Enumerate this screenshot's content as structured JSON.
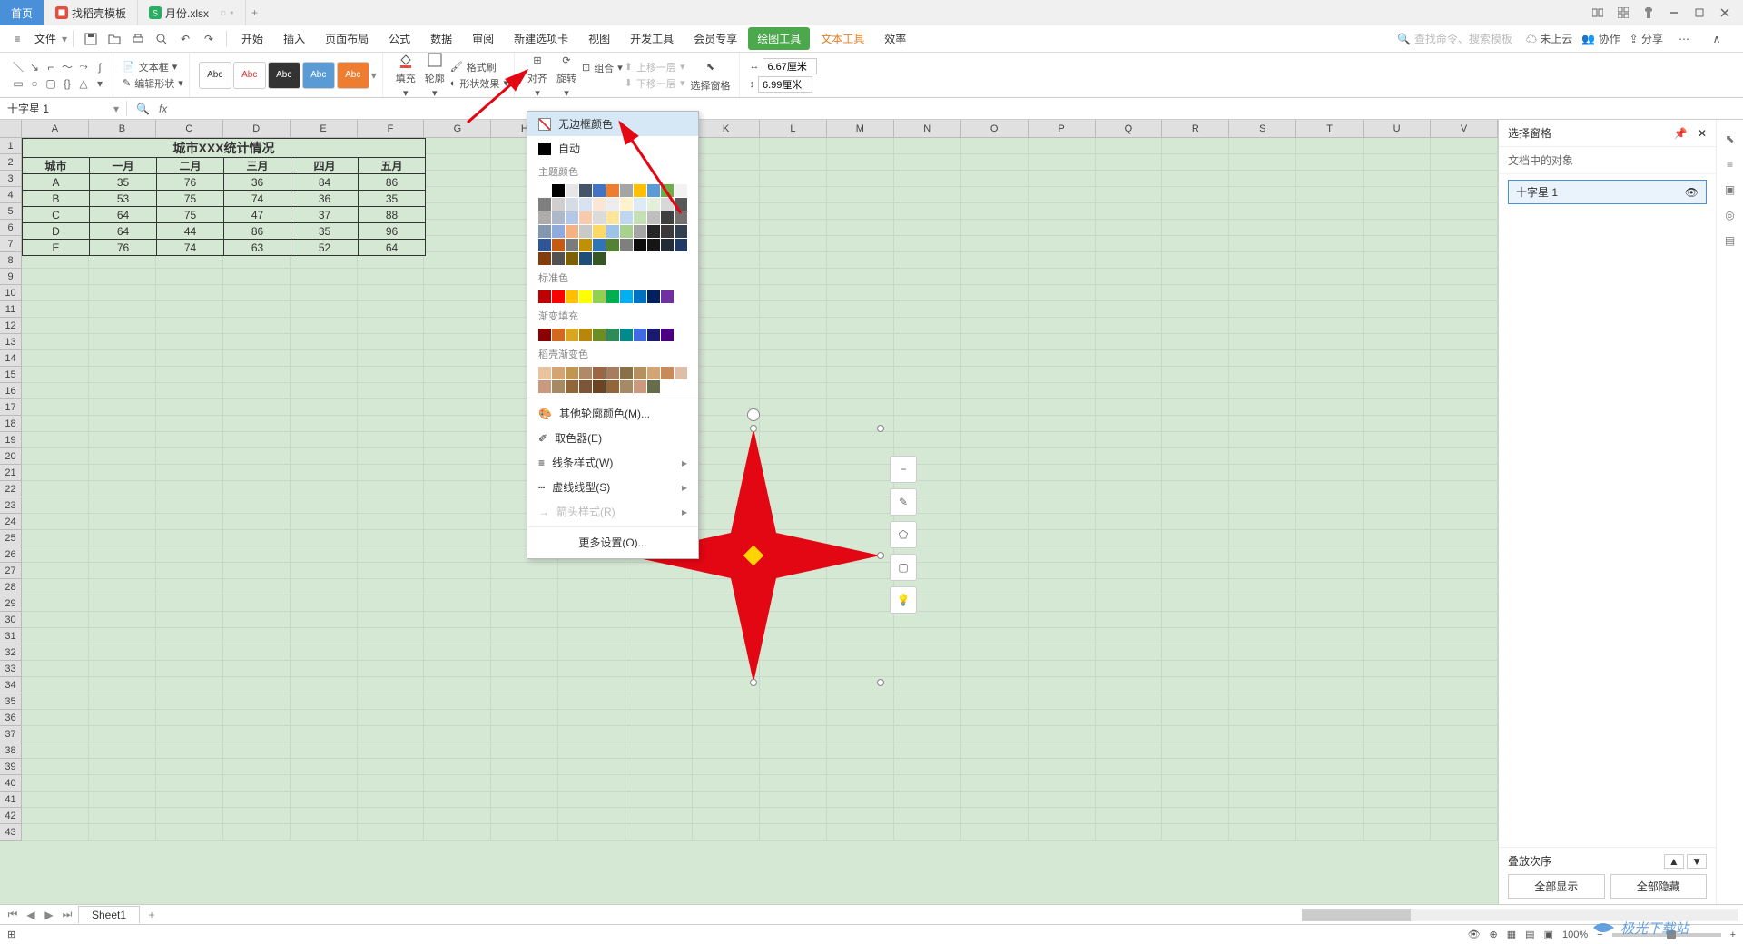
{
  "tabs": {
    "home": "首页",
    "template": "找稻壳模板",
    "file": "月份.xlsx"
  },
  "menu": {
    "file": "文件",
    "items": [
      "开始",
      "插入",
      "页面布局",
      "公式",
      "数据",
      "审阅",
      "新建选项卡",
      "视图",
      "开发工具",
      "会员专享",
      "绘图工具",
      "文本工具",
      "效率"
    ],
    "search_placeholder": "查找命令、搜索模板",
    "cloud": "未上云",
    "coop": "协作",
    "share": "分享"
  },
  "ribbon": {
    "text_box": "文本框",
    "edit_shape": "编辑形状",
    "abc": "Abc",
    "fill": "填充",
    "outline": "轮廓",
    "format_brush": "格式刷",
    "shape_effect": "形状效果",
    "align": "对齐",
    "rotate": "旋转",
    "group": "组合",
    "up_layer": "上移一层",
    "down_layer": "下移一层",
    "select_pane": "选择窗格",
    "width_val": "6.67厘米",
    "height_val": "6.99厘米"
  },
  "namebox": "十字星 1",
  "dropdown": {
    "no_border": "无边框颜色",
    "auto": "自动",
    "theme": "主题颜色",
    "standard": "标准色",
    "gradient": "渐变填充",
    "kdgrad": "稻壳渐变色",
    "other": "其他轮廓颜色(M)...",
    "eyedrop": "取色器(E)",
    "line_style": "线条样式(W)",
    "dash_style": "虚线线型(S)",
    "arrow_style": "箭头样式(R)",
    "more": "更多设置(O)..."
  },
  "table": {
    "title": "城市XXX统计情况",
    "headers": [
      "城市",
      "一月",
      "二月",
      "三月",
      "四月",
      "五月"
    ],
    "rows": [
      [
        "A",
        "35",
        "76",
        "36",
        "84",
        "86"
      ],
      [
        "B",
        "53",
        "75",
        "74",
        "36",
        "35"
      ],
      [
        "C",
        "64",
        "75",
        "47",
        "37",
        "88"
      ],
      [
        "D",
        "64",
        "44",
        "86",
        "35",
        "96"
      ],
      [
        "E",
        "76",
        "74",
        "63",
        "52",
        "64"
      ]
    ]
  },
  "side": {
    "title": "选择窗格",
    "sub": "文档中的对象",
    "obj": "十字星 1",
    "order": "叠放次序",
    "show_all": "全部显示",
    "hide_all": "全部隐藏"
  },
  "sheet_tab": "Sheet1",
  "zoom": "100%",
  "cols": [
    "A",
    "B",
    "C",
    "D",
    "E",
    "F",
    "G",
    "H",
    "I",
    "J",
    "K",
    "L",
    "M",
    "N",
    "O",
    "P",
    "Q",
    "R",
    "S",
    "T",
    "U",
    "V"
  ],
  "watermark": "极光下载站",
  "colors": {
    "theme_row1": [
      "#ffffff",
      "#000000",
      "#e7e6e6",
      "#44546a",
      "#4472c4",
      "#ed7d31",
      "#a5a5a5",
      "#ffc000",
      "#5b9bd5",
      "#70ad47"
    ],
    "theme_shades": [
      [
        "#f2f2f2",
        "#7f7f7f",
        "#d0cece",
        "#d6dce5",
        "#d9e2f3",
        "#fbe5d6",
        "#ededed",
        "#fff2cc",
        "#deebf7",
        "#e2f0d9"
      ],
      [
        "#d8d8d8",
        "#595959",
        "#aeabab",
        "#adb9ca",
        "#b4c7e7",
        "#f7cbac",
        "#dbdbdb",
        "#fee599",
        "#bdd7ee",
        "#c5e0b4"
      ],
      [
        "#bfbfbf",
        "#3f3f3f",
        "#757070",
        "#8497b0",
        "#8faadc",
        "#f4b183",
        "#c9c9c9",
        "#ffd965",
        "#9dc3e6",
        "#a9d18e"
      ],
      [
        "#a5a5a5",
        "#262626",
        "#3a3838",
        "#323f4f",
        "#2f5597",
        "#c55a11",
        "#7b7b7b",
        "#bf9000",
        "#2e75b6",
        "#548235"
      ],
      [
        "#7f7f7f",
        "#0c0c0c",
        "#171616",
        "#222a35",
        "#1f3864",
        "#833c0c",
        "#525252",
        "#7f6000",
        "#1f4e79",
        "#375623"
      ]
    ],
    "standard": [
      "#c00000",
      "#ff0000",
      "#ffc000",
      "#ffff00",
      "#92d050",
      "#00b050",
      "#00b0f0",
      "#0070c0",
      "#002060",
      "#7030a0"
    ],
    "gradient": [
      "#8b0000",
      "#d2691e",
      "#daa520",
      "#b8860b",
      "#6b8e23",
      "#2e8b57",
      "#008b8b",
      "#4169e1",
      "#191970",
      "#4b0082"
    ],
    "kd1": [
      "#e8c39e",
      "#d4a574",
      "#c19552",
      "#b08968",
      "#9c6644",
      "#a87c5f",
      "#8b6f47",
      "#b5915f",
      "#d4a574",
      "#c68b59"
    ],
    "kd2": [
      "#ddbea9",
      "#cb997e",
      "#a68a64",
      "#936639",
      "#7f5539",
      "#6b4423",
      "#936639",
      "#a68a64",
      "#cb997e",
      "#656d4a"
    ]
  }
}
